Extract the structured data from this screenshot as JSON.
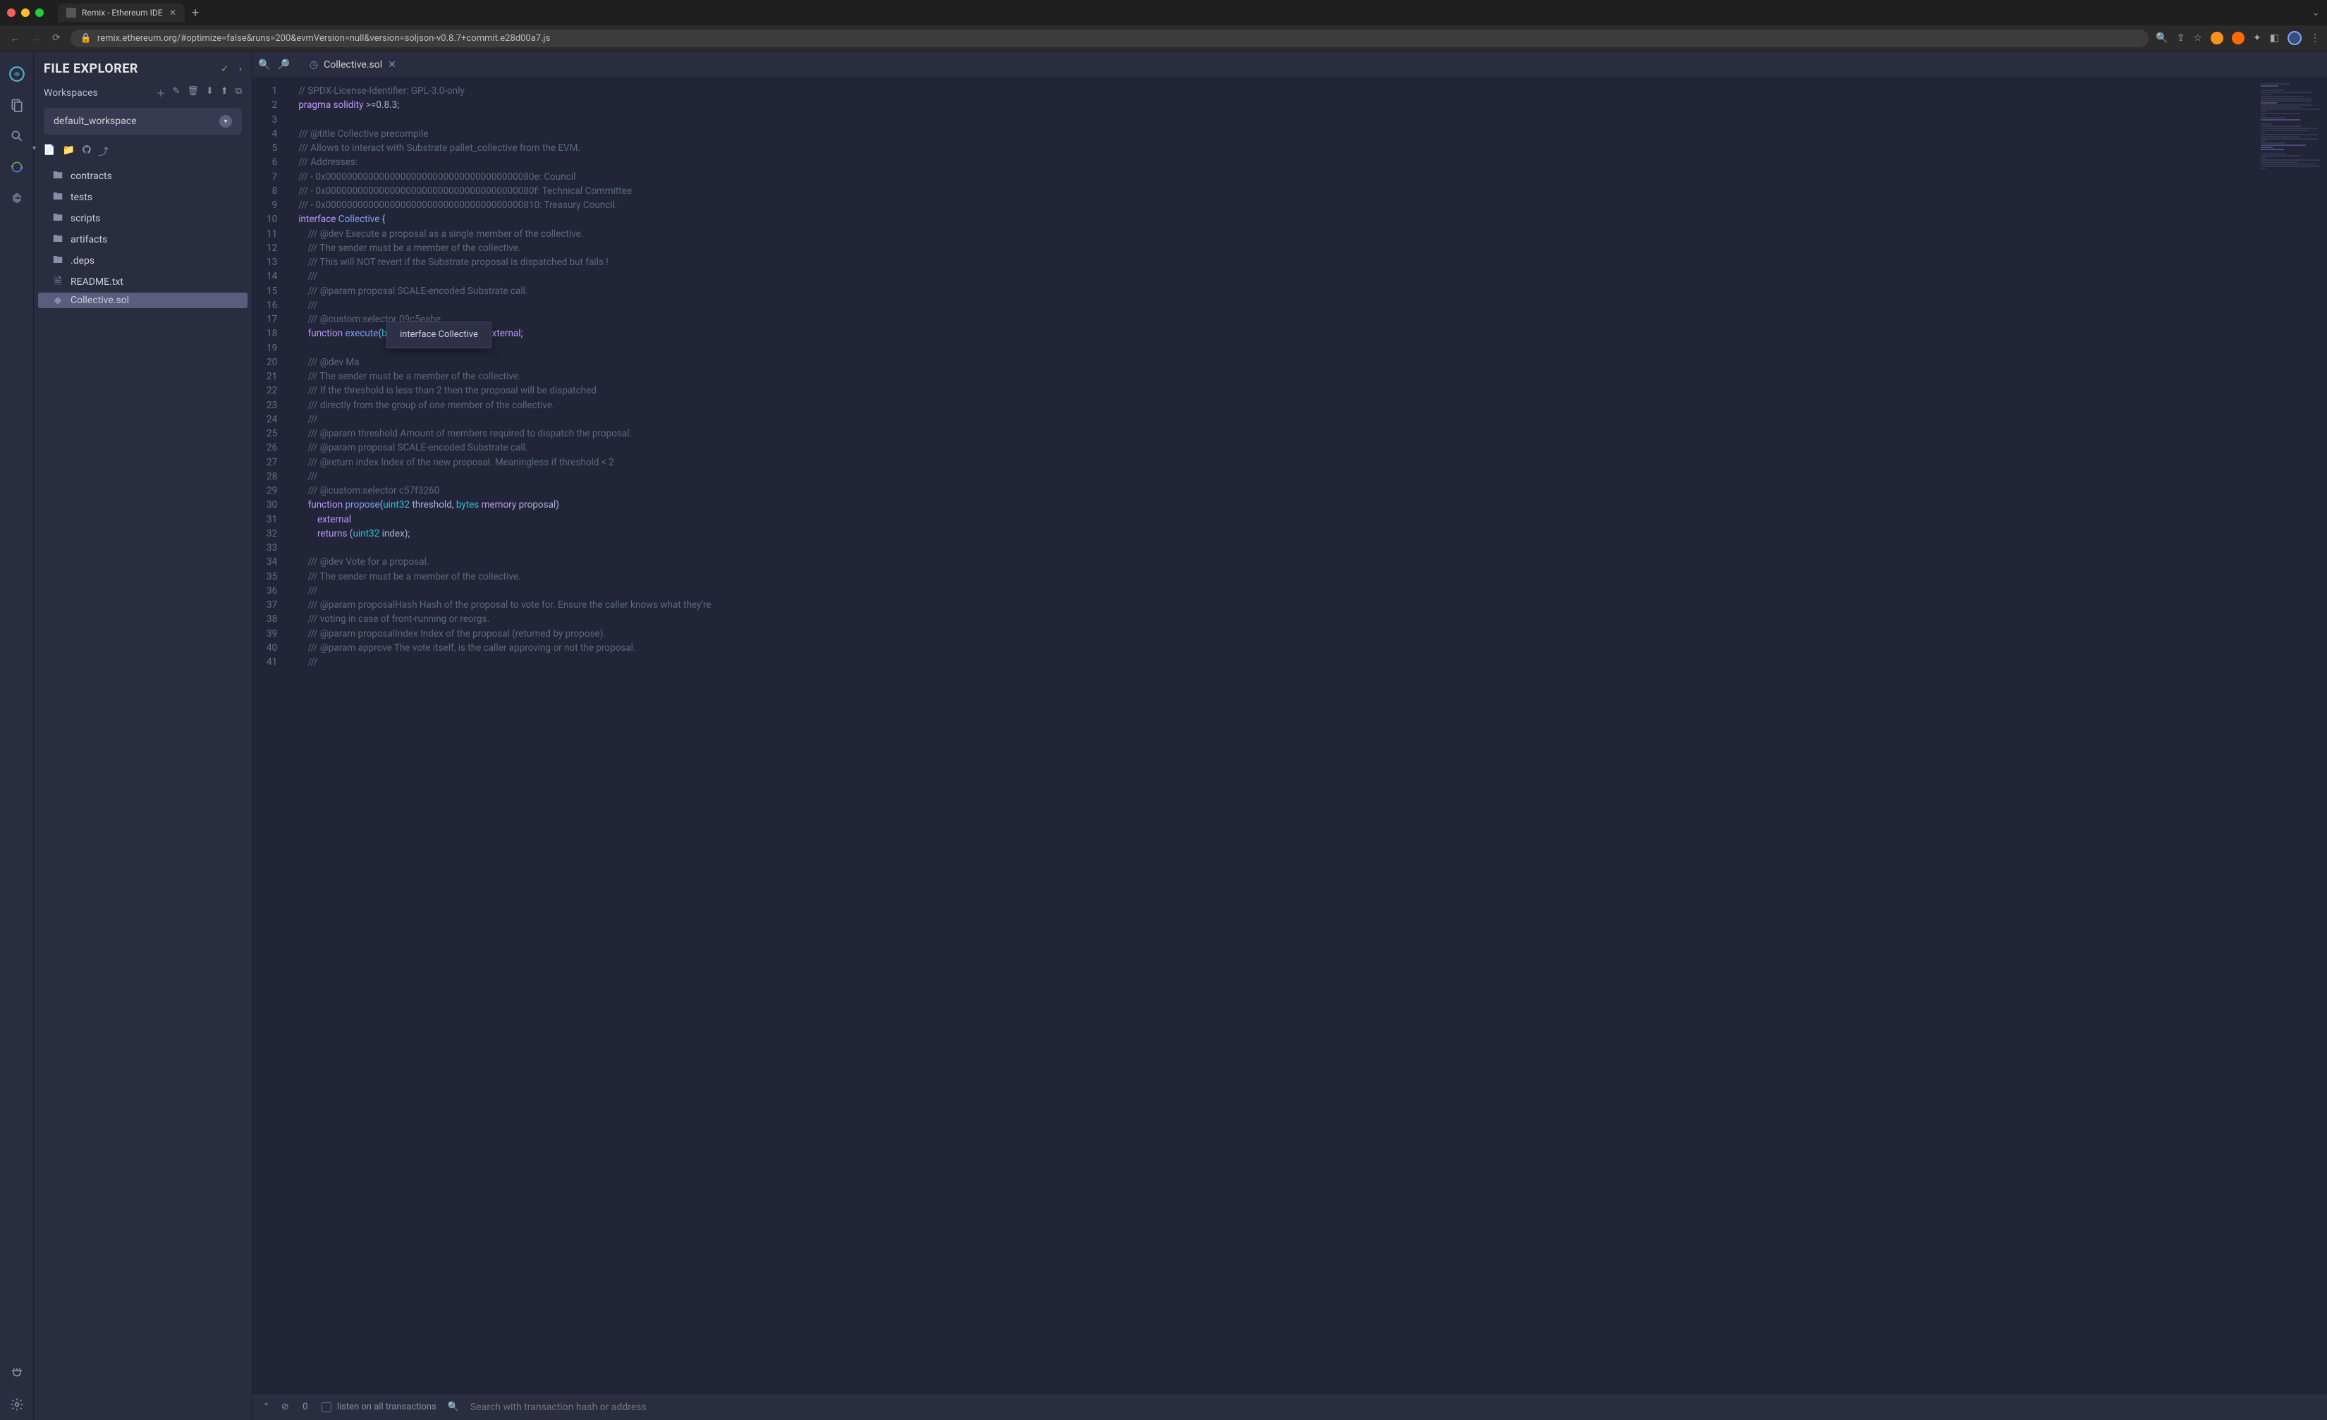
{
  "browser": {
    "tab_title": "Remix - Ethereum IDE",
    "url": "remix.ethereum.org/#optimize=false&runs=200&evmVersion=null&version=soljson-v0.8.7+commit.e28d00a7.js"
  },
  "file_explorer": {
    "title": "FILE EXPLORER",
    "workspaces_label": "Workspaces",
    "selected_workspace": "default_workspace",
    "tree": [
      {
        "type": "folder",
        "name": "contracts"
      },
      {
        "type": "folder",
        "name": "tests"
      },
      {
        "type": "folder",
        "name": "scripts"
      },
      {
        "type": "folder",
        "name": "artifacts"
      },
      {
        "type": "folder",
        "name": ".deps"
      },
      {
        "type": "file",
        "name": "README.txt"
      },
      {
        "type": "file",
        "name": "Collective.sol",
        "active": true
      }
    ]
  },
  "editor": {
    "active_tab": "Collective.sol",
    "hover_tooltip": "interface Collective",
    "line_start": 1,
    "line_end": 41,
    "lines": [
      "// SPDX-License-Identifier: GPL-3.0-only",
      "pragma solidity >=0.8.3;",
      "",
      "/// @title Collective precompile",
      "/// Allows to interact with Substrate pallet_collective from the EVM.",
      "/// Addresses:",
      "/// - 0x000000000000000000000000000000000000080e: Council",
      "/// - 0x000000000000000000000000000000000000080f: Technical Committee",
      "/// - 0x0000000000000000000000000000000000000810: Treasury Council.",
      "interface Collective {",
      "    /// @dev Execute a proposal as a single member of the collective.",
      "    /// The sender must be a member of the collective.",
      "    /// This will NOT revert if the Substrate proposal is dispatched but fails !",
      "    ///",
      "    /// @param proposal SCALE-encoded Substrate call.",
      "    ///",
      "    /// @custom:selector 09c5eabe",
      "    function execute(bytes memory proposal) external;",
      "",
      "    /// @dev Ma",
      "    /// The sender must be a member of the collective.",
      "    /// If the threshold is less than 2 then the proposal will be dispatched",
      "    /// directly from the group of one member of the collective.",
      "    ///",
      "    /// @param threshold Amount of members required to dispatch the proposal.",
      "    /// @param proposal SCALE-encoded Substrate call.",
      "    /// @return index Index of the new proposal. Meaningless if threshold < 2",
      "    ///",
      "    /// @custom:selector c57f3260",
      "    function propose(uint32 threshold, bytes memory proposal)",
      "        external",
      "        returns (uint32 index);",
      "",
      "    /// @dev Vote for a proposal.",
      "    /// The sender must be a member of the collective.",
      "    ///",
      "    /// @param proposalHash Hash of the proposal to vote for. Ensure the caller knows what they're",
      "    /// voting in case of front-running or reorgs.",
      "    /// @param proposalIndex Index of the proposal (returned by propose).",
      "    /// @param approve The vote itself, is the caller approving or not the proposal.",
      "    ///"
    ]
  },
  "terminal": {
    "count": "0",
    "listen_label": "listen on all transactions",
    "search_placeholder": "Search with transaction hash or address"
  }
}
